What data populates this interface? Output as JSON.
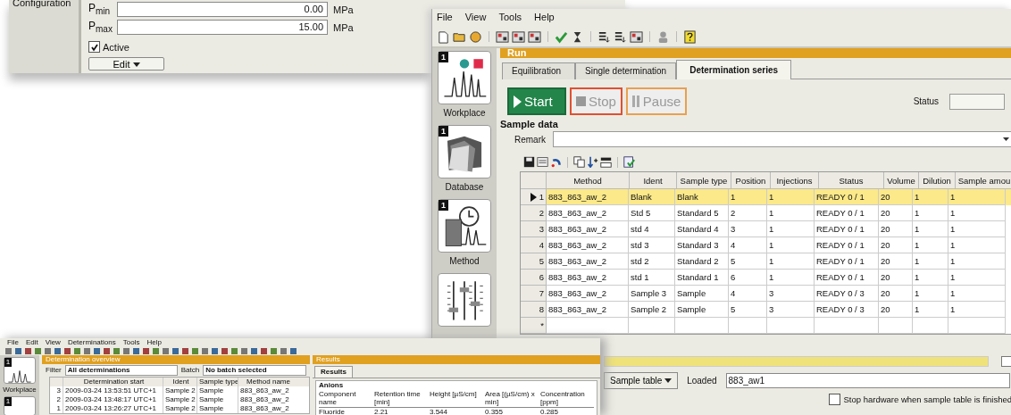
{
  "config_window": {
    "sidebar_label": "Configuration",
    "fields": [
      {
        "label": "P$_{min}$",
        "value": "0.00",
        "unit": "MPa"
      },
      {
        "label": "P$_{max}$",
        "value": "15.00",
        "unit": "MPa"
      }
    ],
    "active": {
      "label": "Active",
      "checked": true
    },
    "edit_button": "Edit"
  },
  "main_window": {
    "menu": [
      "File",
      "View",
      "Tools",
      "Help"
    ],
    "sidebar": [
      {
        "kind": "workplace",
        "label": "Workplace",
        "badge": "1"
      },
      {
        "kind": "database",
        "label": "Database",
        "badge": "1"
      },
      {
        "kind": "method",
        "label": "Method",
        "badge": "1"
      },
      {
        "kind": "sliders"
      }
    ],
    "panel_title": "Run",
    "tabs": [
      {
        "label": "Equilibration",
        "selected": false
      },
      {
        "label": "Single determination",
        "selected": false
      },
      {
        "label": "Determination series",
        "selected": true
      }
    ],
    "buttons": [
      {
        "kind": "start",
        "label": "Start",
        "disabled": false
      },
      {
        "kind": "stop",
        "label": "Stop",
        "disabled": true
      },
      {
        "kind": "pause",
        "label": "Pause",
        "disabled": true
      }
    ],
    "status_label": "Status",
    "section_title": "Sample data",
    "remark_label": "Remark",
    "table": {
      "columns": [
        "Method",
        "Ident",
        "Sample type",
        "Position",
        "Injections",
        "Status",
        "Volume",
        "Dilution",
        "Sample amou"
      ],
      "rows": [
        {
          "number": "1",
          "selected": true,
          "cells": [
            "883_863_aw_2",
            "Blank",
            "Blank",
            "1",
            "1",
            "READY 0 / 1",
            "20",
            "1",
            "1"
          ]
        },
        {
          "number": "2",
          "selected": false,
          "cells": [
            "883_863_aw_2",
            "Std 5",
            "Standard 5",
            "2",
            "1",
            "READY 0 / 1",
            "20",
            "1",
            "1"
          ]
        },
        {
          "number": "3",
          "selected": false,
          "cells": [
            "883_863_aw_2",
            "std 4",
            "Standard 4",
            "3",
            "1",
            "READY 0 / 1",
            "20",
            "1",
            "1"
          ]
        },
        {
          "number": "4",
          "selected": false,
          "cells": [
            "883_863_aw_2",
            "std 3",
            "Standard 3",
            "4",
            "1",
            "READY 0 / 1",
            "20",
            "1",
            "1"
          ]
        },
        {
          "number": "5",
          "selected": false,
          "cells": [
            "883_863_aw_2",
            "std 2",
            "Standard 2",
            "5",
            "1",
            "READY 0 / 1",
            "20",
            "1",
            "1"
          ]
        },
        {
          "number": "6",
          "selected": false,
          "cells": [
            "883_863_aw_2",
            "std 1",
            "Standard 1",
            "6",
            "1",
            "READY 0 / 1",
            "20",
            "1",
            "1"
          ]
        },
        {
          "number": "7",
          "selected": false,
          "cells": [
            "883_863_aw_2",
            "Sample 3",
            "Sample",
            "4",
            "3",
            "READY 0 / 3",
            "20",
            "1",
            "1"
          ]
        },
        {
          "number": "8",
          "selected": false,
          "cells": [
            "883_863_aw_2",
            "Sample 2",
            "Sample",
            "5",
            "3",
            "READY 0 / 3",
            "20",
            "1",
            "1"
          ]
        }
      ],
      "new_row_marker": "*"
    },
    "sample_table_button": "Sample table",
    "loaded_label": "Loaded",
    "loaded_value": "883_aw1",
    "stop_hardware": {
      "label": "Stop hardware when sample table is finished",
      "checked": false
    }
  },
  "overview_window": {
    "menu": [
      "File",
      "Edit",
      "View",
      "Determinations",
      "Tools",
      "Help"
    ],
    "sidebar_label": "Workplace",
    "sidebar_badges": [
      "1",
      "1"
    ],
    "panel_title": "Determination overview",
    "filter_label": "Filter",
    "filter_value": "All determinations",
    "batch_label": "Batch",
    "batch_value": "No batch selected",
    "columns": [
      "Determination start",
      "Ident",
      "Sample type",
      "Method name"
    ],
    "rows": [
      {
        "number": "3",
        "cells": [
          "2009-03-24 13:53:51 UTC+1",
          "Sample 2",
          "Sample",
          "883_863_aw_2"
        ]
      },
      {
        "number": "2",
        "cells": [
          "2009-03-24 13:48:17 UTC+1",
          "Sample 2",
          "Sample",
          "883_863_aw_2"
        ]
      },
      {
        "number": "1",
        "cells": [
          "2009-03-24 13:26:27 UTC+1",
          "Sample 2",
          "Sample",
          "883_863_aw_2"
        ]
      }
    ],
    "results_title": "Results",
    "results_tab": "Results",
    "results_group": "Anions",
    "results_columns": [
      "Component name",
      "Retention time [min]",
      "Height [µS/cm]",
      "Area [(µS/cm) x min]",
      "Concentration [ppm]"
    ],
    "results_rows": [
      [
        "Fluoride",
        "2.21",
        "3.544",
        "0.355",
        "0.285"
      ]
    ]
  }
}
